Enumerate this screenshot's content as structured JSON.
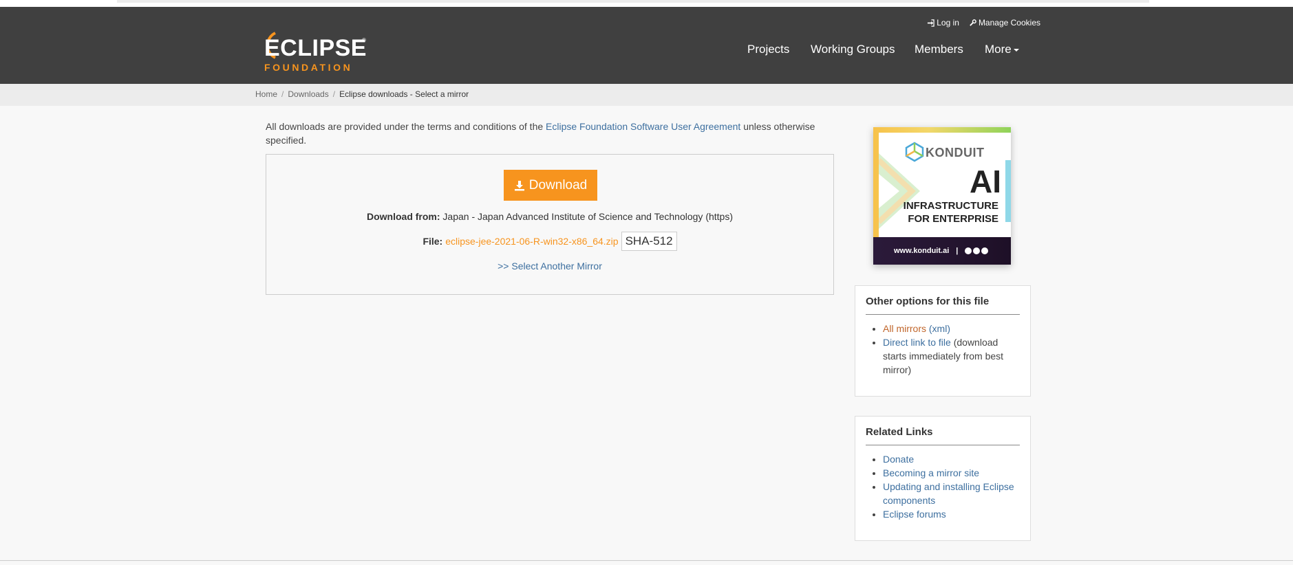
{
  "header": {
    "utility": {
      "login": "Log in",
      "cookies": "Manage Cookies"
    },
    "logo": {
      "main": "ECLIPSE",
      "sub": "FOUNDATION"
    },
    "nav": [
      {
        "label": "Projects"
      },
      {
        "label": "Working Groups"
      },
      {
        "label": "Members"
      },
      {
        "label": "More"
      }
    ]
  },
  "breadcrumb": {
    "home": "Home",
    "downloads": "Downloads",
    "current": "Eclipse downloads - Select a mirror",
    "separator": "/"
  },
  "terms": {
    "prefix": "All downloads are provided under the terms and conditions of the",
    "link": "Eclipse Foundation Software User Agreement",
    "suffix": "unless otherwise specified."
  },
  "download": {
    "button_label": "Download",
    "from_label": "Download from:",
    "from_value": "Japan - Japan Advanced Institute of Science and Technology (https)",
    "file_label": "File:",
    "file_name": "eclipse-jee-2021-06-R-win32-x86_64.zip",
    "sha_label": "SHA-512",
    "another_mirror": ">> Select Another Mirror"
  },
  "ad": {
    "brand": "KONDUIT",
    "big": "AI",
    "line1": "INFRASTRUCTURE",
    "line2": "FOR ENTERPRISE",
    "url": "www.konduit.ai",
    "divider": "|"
  },
  "other_options": {
    "title": "Other options for this file",
    "all_mirrors": "All mirrors",
    "xml": "(xml)",
    "direct_link": "Direct link to file",
    "direct_note": "(download starts immediately from best mirror)"
  },
  "related_links": {
    "title": "Related Links",
    "items": [
      "Donate",
      "Becoming a mirror site",
      "Updating and installing Eclipse components",
      "Eclipse forums"
    ]
  },
  "colors": {
    "header_bg": "#404040",
    "accent": "#f7941e",
    "link": "#3d6f9f"
  }
}
